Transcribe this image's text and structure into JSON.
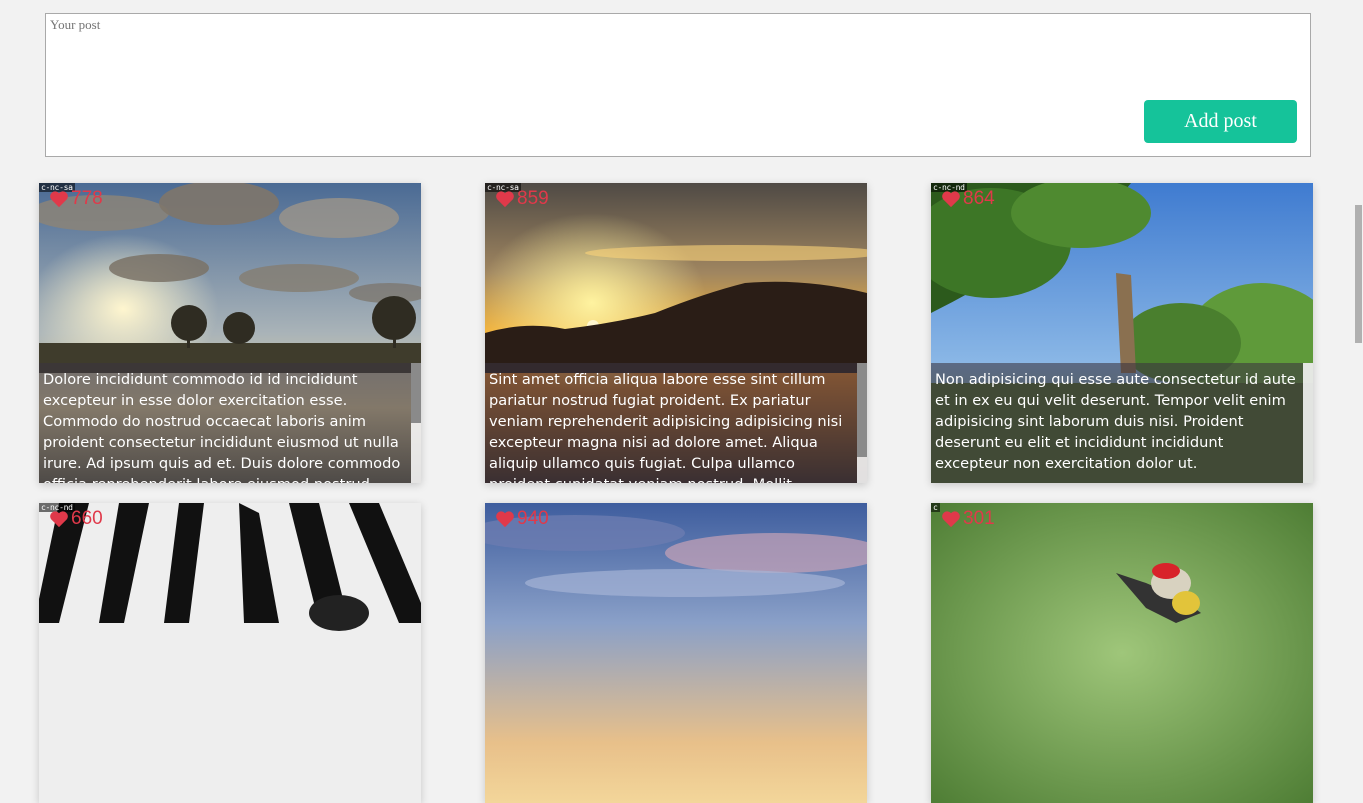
{
  "composer": {
    "placeholder": "Your post",
    "value": "",
    "add_button_label": "Add post"
  },
  "posts": [
    {
      "license": "c-nc-sa",
      "likes": "778",
      "scene": "sunset-clouds",
      "text": "Dolore incididunt commodo id id incididunt excepteur in esse dolor exercitation esse. Commodo do nostrud occaecat laboris anim proident consectetur incididunt eiusmod ut nulla irure. Ad ipsum quis ad et. Duis dolore commodo officia reprehenderit labore eiusmod nostrud"
    },
    {
      "license": "c-nc-sa",
      "likes": "859",
      "scene": "orange-sunset",
      "text": "Sint amet officia aliqua labore esse sint cillum pariatur nostrud fugiat proident. Ex pariatur veniam reprehenderit adipisicing adipisicing nisi excepteur magna nisi ad dolore amet. Aliqua aliquip ullamco quis fugiat. Culpa ullamco proident cupidatat veniam nostrud. Mollit excepteur exercitation"
    },
    {
      "license": "c-nc-nd",
      "likes": "864",
      "scene": "forest-sky",
      "text": "Non adipisicing qui esse aute consectetur id aute et in ex eu qui velit deserunt. Tempor velit enim adipisicing sint laborum duis nisi. Proident deserunt eu elit et incididunt incididunt excepteur non exercitation dolor ut."
    },
    {
      "license": "c-nc-nd",
      "likes": "660",
      "scene": "zebra",
      "text": ""
    },
    {
      "license": "",
      "likes": "940",
      "scene": "blue-sky",
      "text": ""
    },
    {
      "license": "c",
      "likes": "301",
      "scene": "woodpecker",
      "text": ""
    }
  ],
  "colors": {
    "accent": "#15c39a",
    "heart": "#e0394a",
    "background": "#f2f2f2"
  }
}
